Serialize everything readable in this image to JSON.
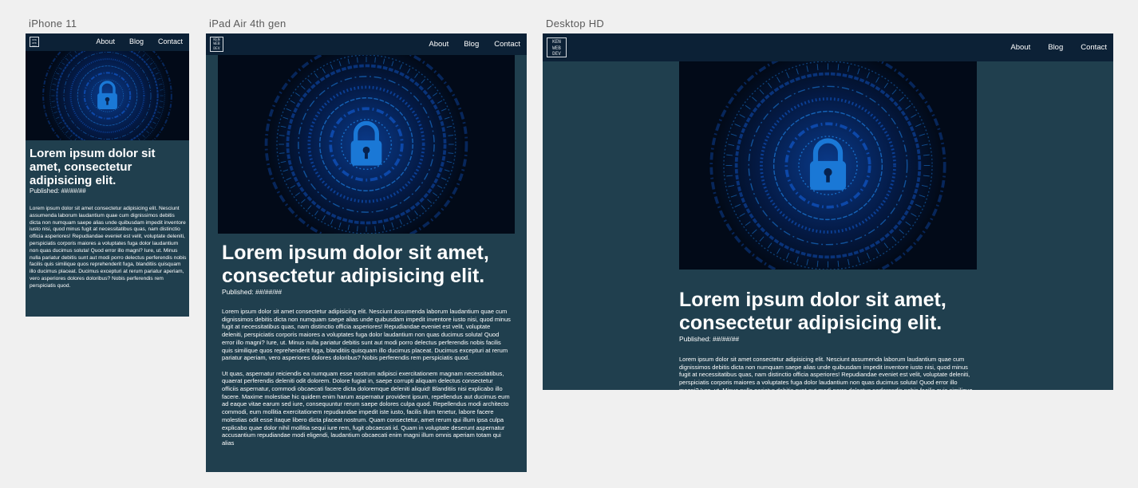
{
  "frames": {
    "iphone": {
      "label": "iPhone 11"
    },
    "ipad": {
      "label": "iPad Air 4th gen"
    },
    "desktop": {
      "label": "Desktop HD"
    }
  },
  "nav": {
    "about": "About",
    "blog": "Blog",
    "contact": "Contact"
  },
  "logo": {
    "lines": [
      "KEN",
      "WEB",
      "DEV"
    ]
  },
  "post": {
    "title": "Lorem ipsum dolor sit amet, consectetur adipisicing elit.",
    "published": "Published: ##/##/##",
    "paragraph1": "Lorem ipsum dolor sit amet consectetur adipisicing elit. Nesciunt assumenda laborum laudantium quae cum dignissimos debitis dicta non numquam saepe alias unde quibusdam impedit inventore iusto nisi, quod minus fugit at necessitatibus quas, nam distinctio officia asperiores! Repudiandae eveniet est velit, voluptate deleniti, perspiciatis corporis maiores a voluptates fuga dolor laudantium non quas ducimus soluta! Quod error illo magni? Iure, ut. Minus nulla pariatur debitis sunt aut modi porro delectus perferendis nobis facilis quis similique quos reprehenderit fuga, blanditiis quisquam illo ducimus placeat. Ducimus excepturi at rerum pariatur aperiam, vero asperiores dolores doloribus? Nobis perferendis rem perspiciatis quod.",
    "paragraph2": "Ut quas, aspernatur reiciendis ea numquam esse nostrum adipisci exercitationem magnam necessitatibus, quaerat perferendis deleniti odit dolorem. Dolore fugiat in, saepe corrupti aliquam delectus consectetur officiis aspernatur, commodi obcaecati facere dicta doloremque deleniti aliquid! Blanditiis nisi explicabo illo facere. Maxime molestiae hic quidem enim harum aspernatur provident ipsum, repellendus aut ducimus eum ad eaque vitae earum sed iure, consequuntur rerum saepe dolores culpa quod. Repellendus modi architecto commodi, eum mollitia exercitationem repudiandae impedit iste iusto, facilis illum tenetur, labore facere molestias odit esse itaque libero dicta placeat nostrum. Quam consectetur, amet rerum qui illum ipsa culpa explicabo quae dolor nihil mollitia sequi iure rem, fugit obcaecati id. Quam in voluptate deserunt aspernatur accusantium repudiandae modi eligendi, laudantium obcaecati enim magni illum omnis aperiam totam qui alias"
  },
  "hero": {
    "icon": "padlock-icon",
    "accent": "#1a78d6",
    "ring": "#0f4fb8",
    "background": "#020a18"
  },
  "colors": {
    "nav": "#0c2136",
    "page": "#203f4e",
    "canvas": "#f0f0f0"
  }
}
